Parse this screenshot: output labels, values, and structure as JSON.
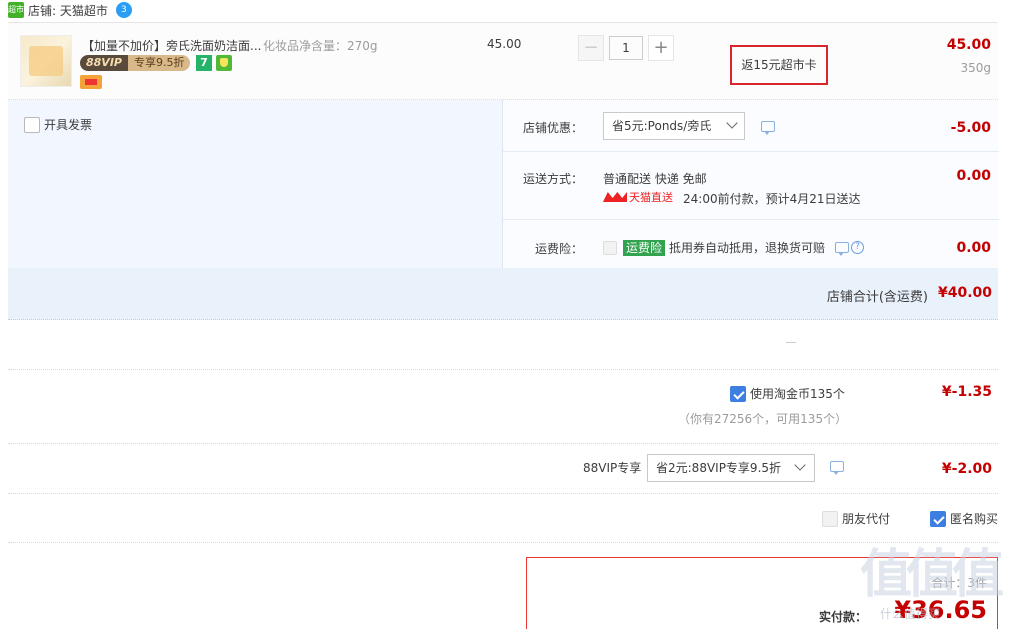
{
  "shop": {
    "logo_text": "超市",
    "label": "店铺: 天猫超市",
    "ww_badge": "3"
  },
  "item": {
    "title": "【加量不加价】旁氏洗面奶洁面...",
    "sku": "化妆品净含量：270g",
    "vip_tag_left": "88VIP",
    "vip_tag_right": "专享9.5折",
    "tag_seven": "7",
    "unit_price": "45.00",
    "quantity": "1",
    "minus_label": "−",
    "plus_label": "+",
    "rebate": "返15元超市卡",
    "total": "45.00",
    "weight": "350g"
  },
  "invoice": {
    "label": "开具发票",
    "checked": false
  },
  "options": {
    "coupon": {
      "label": "店铺优惠：",
      "selected": "省5元:Ponds/旁氏",
      "value": "-5.00"
    },
    "shipping": {
      "label": "运送方式：",
      "method": "普通配送 快递 免邮",
      "carrier": "天猫直送",
      "eta": "24:00前付款，预计4月21日送达",
      "value": "0.00"
    },
    "insurance": {
      "label": "运费险：",
      "badge": "运费险",
      "text": "抵用券自动抵用，退换货可赔",
      "value": "0.00"
    }
  },
  "shop_total": {
    "label": "店铺合计(含运费)",
    "value": "¥40.00"
  },
  "coins": {
    "label": "使用淘金币135个",
    "sub": "（你有27256个，可用135个）",
    "value": "¥-1.35",
    "checked": true
  },
  "vip": {
    "label": "88VIP专享",
    "selected": "省2元:88VIP专享9.5折",
    "value": "¥-2.00"
  },
  "friend_pay": {
    "label": "朋友代付",
    "checked": false
  },
  "anon_buy": {
    "label": "匿名购买",
    "checked": true
  },
  "pay": {
    "sub": "合计：3件",
    "label": "实付款：",
    "amount": "¥36.65"
  },
  "watermark": {
    "glyphs": "值",
    "sub": "什么值得买"
  },
  "colors": {
    "price_red": "#c40000",
    "accent_blue": "#3d7fe0",
    "rebate_border": "#d9262c"
  }
}
